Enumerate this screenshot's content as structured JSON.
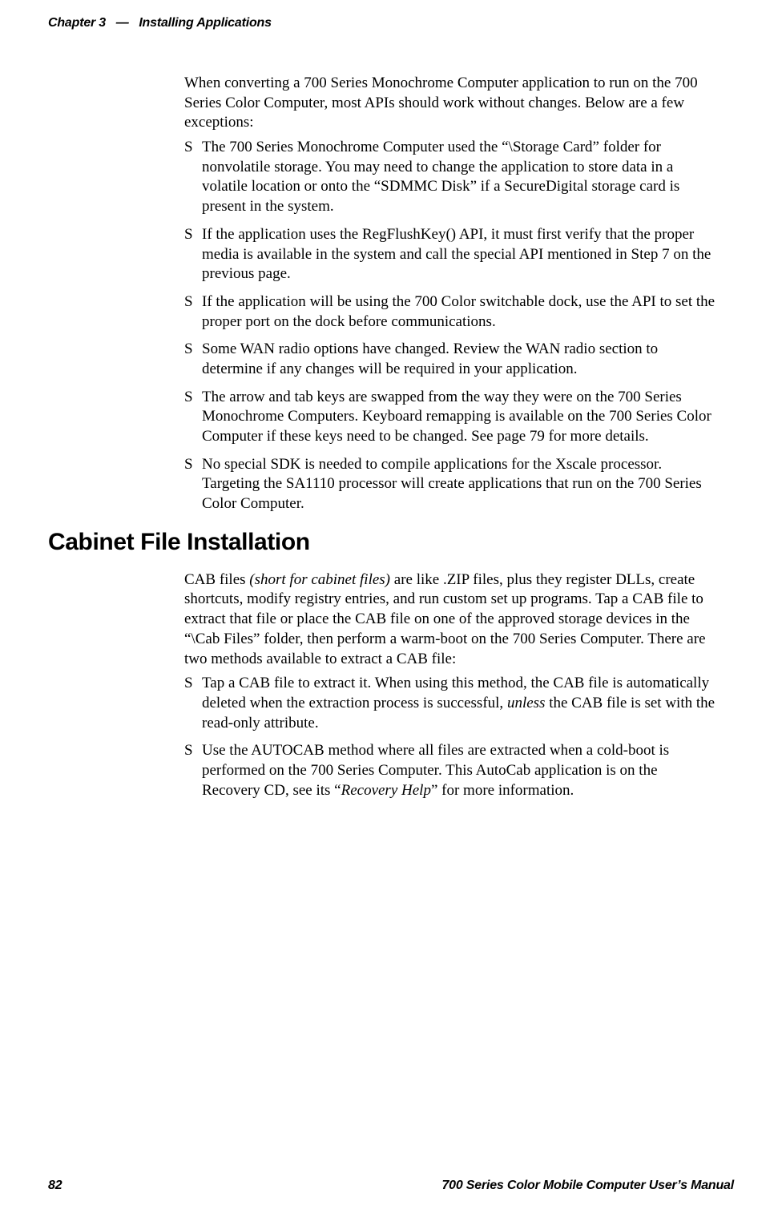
{
  "header": {
    "chapter_label": "Chapter 3",
    "separator": "—",
    "chapter_title": "Installing Applications"
  },
  "intro_para": "When converting a 700 Series Monochrome Computer application to run on the 700 Series Color Computer, most APIs should work without changes. Below are a few exceptions:",
  "bullets1": [
    "The 700 Series Monochrome Computer used the “\\Storage Card” folder for nonvolatile storage. You may need to change the application to store data in a volatile location or onto the “SDMMC Disk” if a SecureDigital storage card is present in the system.",
    "If the application uses the RegFlushKey() API, it must first verify that the proper media is available in the system and call the special API mentioned in Step 7 on the previous page.",
    "If the application will be using the 700 Color switchable dock, use the API to set the proper port on the dock before communications.",
    "Some WAN radio options have changed. Review the WAN radio section to determine if any changes will be required in your application.",
    "The arrow and tab keys are swapped from the way they were on the 700 Series Monochrome Computers. Keyboard remapping is available on the 700 Series Color Computer if these keys need to be changed. See page 79 for more details.",
    "No special SDK is needed to compile applications for the Xscale processor. Targeting the SA1110 processor will create applications that run on the 700 Series Color Computer."
  ],
  "section_heading": "Cabinet File Installation",
  "cab_para_pre": "CAB files ",
  "cab_para_italic": "(short for cabinet files)",
  "cab_para_post": " are like .ZIP files, plus they register DLLs, create shortcuts, modify registry entries, and run custom set up programs. Tap a CAB file to extract that file or place the CAB file on one of the approved storage devices in the “\\Cab Files” folder, then perform a warm-boot on the 700 Series Computer. There are two methods available to extract a CAB file:",
  "bullets2_item1_pre": "Tap a CAB file to extract it. When using this method, the CAB file is automatically deleted when the extraction process is successful, ",
  "bullets2_item1_italic": "unless",
  "bullets2_item1_post": " the CAB file is set with the read-only attribute.",
  "bullets2_item2_pre": "Use the AUTOCAB method where all files are extracted when a cold-boot is performed on the 700 Series Computer. This AutoCab application is on the Recovery CD, see its “",
  "bullets2_item2_italic": "Recovery Help",
  "bullets2_item2_post": "” for more information.",
  "footer": {
    "page_number": "82",
    "manual_title": "700 Series Color Mobile Computer User’s Manual"
  }
}
